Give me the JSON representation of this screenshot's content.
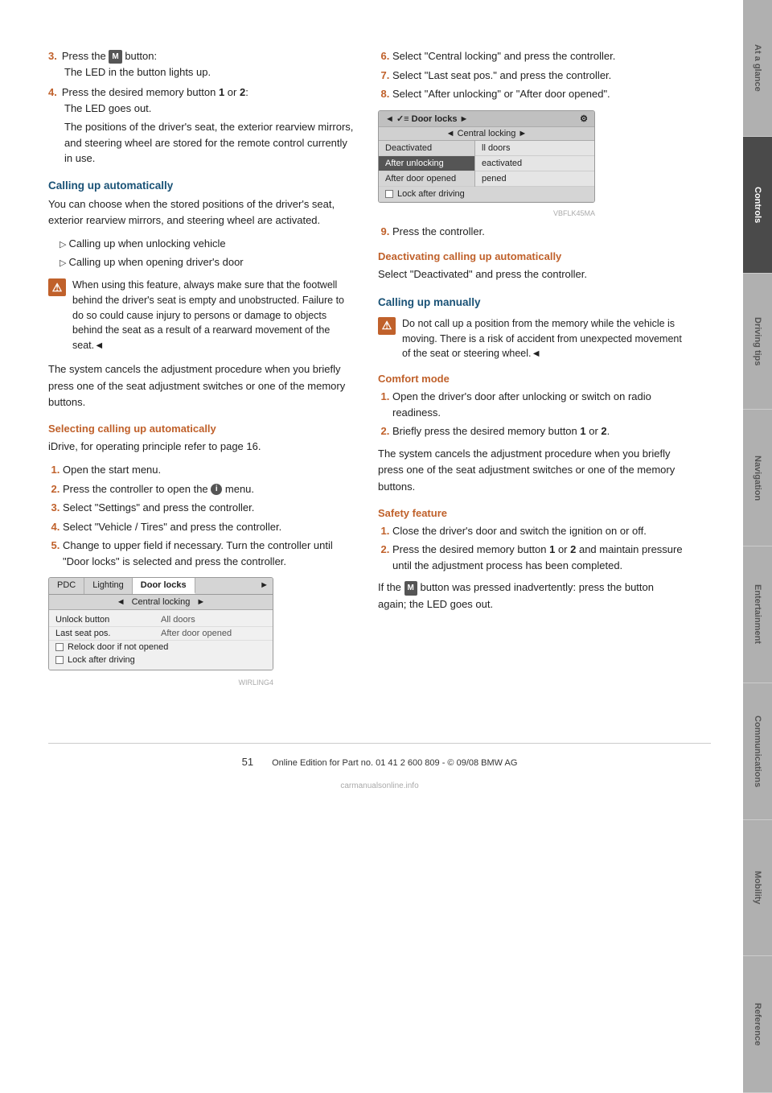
{
  "page": {
    "number": "51",
    "footer": "Online Edition for Part no. 01 41 2 600 809 - © 09/08 BMW AG"
  },
  "tabs": [
    {
      "id": "at-a-glance",
      "label": "At a glance",
      "active": false
    },
    {
      "id": "controls",
      "label": "Controls",
      "active": true
    },
    {
      "id": "driving-tips",
      "label": "Driving tips",
      "active": false
    },
    {
      "id": "navigation",
      "label": "Navigation",
      "active": false
    },
    {
      "id": "entertainment",
      "label": "Entertainment",
      "active": false
    },
    {
      "id": "communications",
      "label": "Communications",
      "active": false
    },
    {
      "id": "mobility",
      "label": "Mobility",
      "active": false
    },
    {
      "id": "reference",
      "label": "Reference",
      "active": false
    }
  ],
  "left_col": {
    "step3_label": "3.",
    "step3_text_a": "Press the",
    "step3_m_btn": "M",
    "step3_text_b": "button:",
    "step3_sub": "The LED in the button lights up.",
    "step4_label": "4.",
    "step4_text": "Press the desired memory button 1 or 2:",
    "step4_sub": "The LED goes out.",
    "step4_detail": "The positions of the driver's seat, the exterior rearview mirrors, and steering wheel are stored for the remote control currently in use.",
    "calling_up_auto_heading": "Calling up automatically",
    "calling_up_auto_text": "You can choose when the stored positions of the driver's seat, exterior rearview mirrors, and steering wheel are activated.",
    "bullet1": "Calling up when unlocking vehicle",
    "bullet2": "Calling up when opening driver's door",
    "warning_text": "When using this feature, always make sure that the footwell behind the driver's seat is empty and unobstructed. Failure to do so could cause injury to persons or damage to objects behind the seat as a result of a rearward movement of the seat.◄",
    "system_cancels_text": "The system cancels the adjustment procedure when you briefly press one of the seat adjustment switches or one of the memory buttons.",
    "selecting_heading": "Selecting calling up automatically",
    "idrive_text": "iDrive, for operating principle refer to page 16.",
    "steps": [
      {
        "num": "1.",
        "text": "Open the start menu."
      },
      {
        "num": "2.",
        "text": "Press the controller to open the i menu."
      },
      {
        "num": "3.",
        "text": "Select \"Settings\" and press the controller."
      },
      {
        "num": "4.",
        "text": "Select \"Vehicle / Tires\" and press the controller."
      },
      {
        "num": "5.",
        "text": "Change to upper field if necessary. Turn the controller until \"Door locks\" is selected and press the controller."
      }
    ],
    "screen1": {
      "tabs": [
        "PDC",
        "Lighting",
        "Door locks"
      ],
      "active_tab": "Door locks",
      "sub_header": "◄ Central locking ►",
      "rows": [
        {
          "left": "Unlock button",
          "right": "All doors"
        },
        {
          "left": "Last seat pos.",
          "right": "After door opened"
        }
      ],
      "checkbox_rows": [
        {
          "checked": false,
          "label": "Relock door if not opened"
        },
        {
          "checked": false,
          "label": "Lock after driving"
        }
      ]
    }
  },
  "right_col": {
    "step6_label": "6.",
    "step6_text": "Select \"Central locking\" and press the controller.",
    "step7_label": "7.",
    "step7_text": "Select \"Last seat pos.\" and press the controller.",
    "step8_label": "8.",
    "step8_text": "Select \"After unlocking\" or \"After door opened\".",
    "screen2": {
      "header": "◄ ✓ ≡ Door locks ►",
      "settings_icon": "⚙",
      "sub_header": "◄ Central locking ►",
      "left_items": [
        {
          "label": "Deactivated",
          "selected": false
        },
        {
          "label": "After unlocking",
          "selected": true
        },
        {
          "label": "After door opened",
          "selected": false
        }
      ],
      "right_items": [
        {
          "label": "ll doors",
          "strikethrough": false
        },
        {
          "label": "eactivated",
          "strikethrough": false
        },
        {
          "label": "pened",
          "strikethrough": false
        }
      ],
      "checkbox_row": {
        "checked": false,
        "label": "Lock after driving"
      }
    },
    "step9_label": "9.",
    "step9_text": "Press the controller.",
    "deactivating_heading": "Deactivating calling up automatically",
    "deactivating_text": "Select \"Deactivated\" and press the controller.",
    "calling_manually_heading": "Calling up manually",
    "calling_manually_warning": "Do not call up a position from the memory while the vehicle is moving. There is a risk of accident from unexpected movement of the seat or steering wheel.◄",
    "comfort_mode_heading": "Comfort mode",
    "comfort_step1": "Open the driver's door after unlocking or switch on radio readiness.",
    "comfort_step2": "Briefly press the desired memory button 1 or 2.",
    "comfort_system_text": "The system cancels the adjustment procedure when you briefly press one of the seat adjustment switches or one of the memory buttons.",
    "safety_feature_heading": "Safety feature",
    "safety_step1": "Close the driver's door and switch the ignition on or off.",
    "safety_step2": "Press the desired memory button 1 or 2 and maintain pressure until the adjustment process has been completed.",
    "if_m_text_a": "If the",
    "m_btn": "M",
    "if_m_text_b": "button was pressed inadvertently: press the button again; the LED goes out."
  }
}
